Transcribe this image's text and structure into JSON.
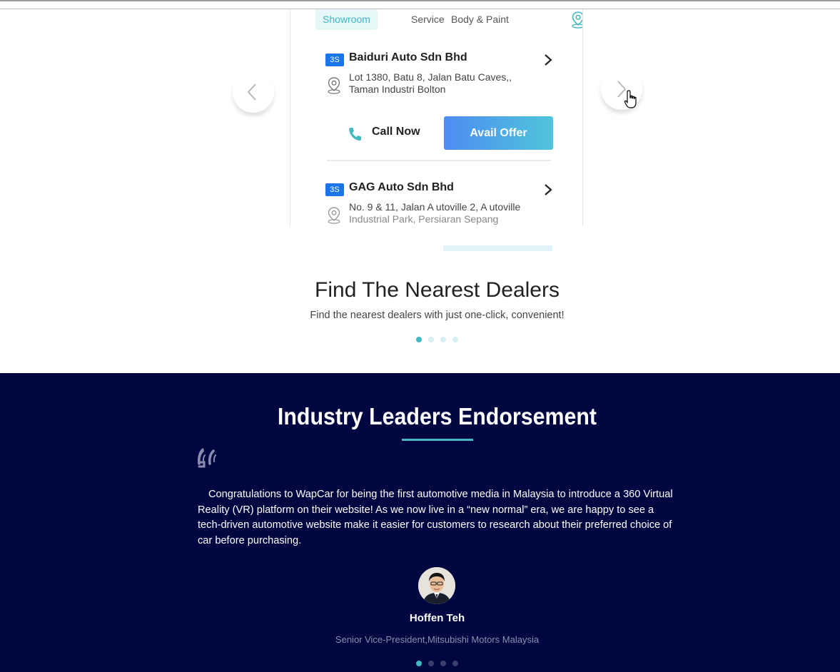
{
  "dealer_finder": {
    "tabs": [
      {
        "label": "Showroom",
        "active": true
      },
      {
        "label": "Service",
        "active": false
      },
      {
        "label": "Body & Paint",
        "active": false
      }
    ],
    "dealers": [
      {
        "badge": "3S",
        "name": "Baiduri Auto Sdn Bhd",
        "address_line1": "Lot 1380, Batu 8, Jalan Batu Caves,,",
        "address_line2": "Taman Industri Bolton",
        "call_label": "Call Now",
        "offer_label": "Avail Offer"
      },
      {
        "badge": "3S",
        "name": "GAG Auto Sdn Bhd",
        "address_line1": "No. 9 & 11, Jalan A utoville 2, A utoville",
        "address_line2": "Industrial Park, Persiaran Sepang"
      }
    ]
  },
  "carousel": {
    "title": "Find The Nearest Dealers",
    "subtitle": "Find the nearest dealers with just one-click, convenient!",
    "active_slide": 1,
    "slide_count": 4
  },
  "endorsement": {
    "title": "Industry Leaders Endorsement",
    "quote": "Congratulations to WapCar for being the first automotive media in Malaysia to introduce a 360 Virtual Reality (VR) platform on their website! As we now live in a “new normal” era, we are happy to see a tech-driven automotive website make it easier for customers to research about their preferred choice of car before purchasing.",
    "person_name": "Hoffen Teh",
    "person_title": "Senior Vice-President,Mitsubishi Motors Malaysia",
    "active_slide": 1,
    "slide_count": 4
  },
  "colors": {
    "accent": "#43b9c2",
    "brand_blue": "#1b74e8",
    "navy_background": "#000640"
  }
}
